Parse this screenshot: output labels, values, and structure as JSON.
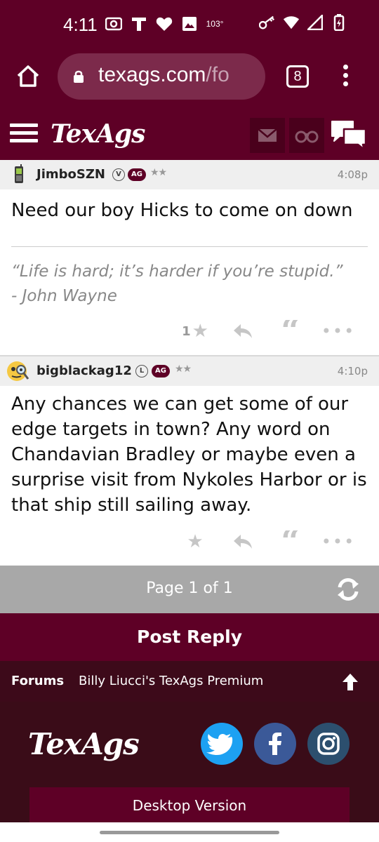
{
  "status_bar": {
    "time": "4:11",
    "temperature": "103°",
    "icons_left": [
      "radio-icon",
      "t-mobile-icon",
      "heart-icon",
      "image-icon"
    ],
    "icons_right": [
      "key-icon",
      "wifi-icon",
      "signal-icon",
      "battery-charging-icon"
    ]
  },
  "browser": {
    "url_host": "texags.com",
    "url_path": "/fo",
    "tab_count": "8"
  },
  "site_header": {
    "logo": "TexAgs"
  },
  "posts": [
    {
      "username": "JimboSZN",
      "badge_letter": "V",
      "badge_ag": "AG",
      "stars": "★★",
      "time": "4:08p",
      "body": "Need our boy Hicks to come on down",
      "signature_line1": "“Life is hard; it’s harder if you’re stupid.”",
      "signature_line2": "- John Wayne",
      "like_count": "1"
    },
    {
      "username": "bigblackag12",
      "badge_letter": "L",
      "badge_ag": "AG",
      "stars": "★★",
      "time": "4:10p",
      "body": "Any chances we can get some of our edge targets in town? Any word on Chandavian Bradley or maybe even a surprise visit from Nykoles Harbor or is that ship still sailing away."
    }
  ],
  "pagination": {
    "text": "Page 1 of 1"
  },
  "post_reply": {
    "label": "Post Reply"
  },
  "breadcrumb": {
    "forums": "Forums",
    "board": "Billy Liucci's TexAgs Premium"
  },
  "footer": {
    "logo": "TexAgs",
    "desktop_version": "Desktop Version",
    "social": [
      "twitter-icon",
      "facebook-icon",
      "instagram-icon"
    ]
  },
  "colors": {
    "maroon": "#5e0026",
    "footer_bg": "#3a0c18",
    "twitter": "#1da1f2",
    "facebook": "#3b5998",
    "instagram": "#2c4f6e"
  }
}
